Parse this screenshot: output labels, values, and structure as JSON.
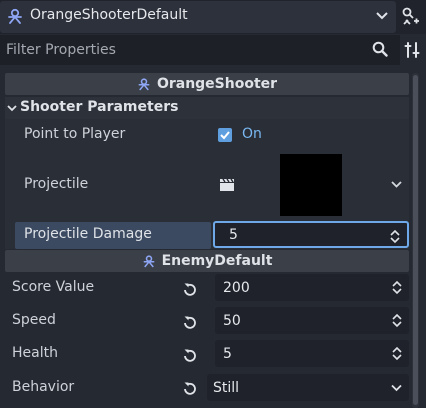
{
  "object_bar": {
    "title": "OrangeShooterDefault"
  },
  "filter": {
    "placeholder": "Filter Properties"
  },
  "sections": {
    "orange": {
      "title": "OrangeShooter"
    },
    "group": {
      "title": "Shooter Parameters"
    },
    "enemy": {
      "title": "EnemyDefault"
    }
  },
  "properties": {
    "point_to_player": {
      "label": "Point to Player",
      "value_text": "On",
      "checked": true
    },
    "projectile": {
      "label": "Projectile"
    },
    "projectile_damage": {
      "label": "Projectile Damage",
      "value": "5"
    },
    "score_value": {
      "label": "Score Value",
      "value": "200"
    },
    "speed": {
      "label": "Speed",
      "value": "50"
    },
    "health": {
      "label": "Health",
      "value": "5"
    },
    "behavior": {
      "label": "Behavior",
      "value": "Still"
    }
  },
  "colors": {
    "accent": "#5f9fe0",
    "script_icon": "#8da5f3",
    "selection": "#3b4a61"
  }
}
